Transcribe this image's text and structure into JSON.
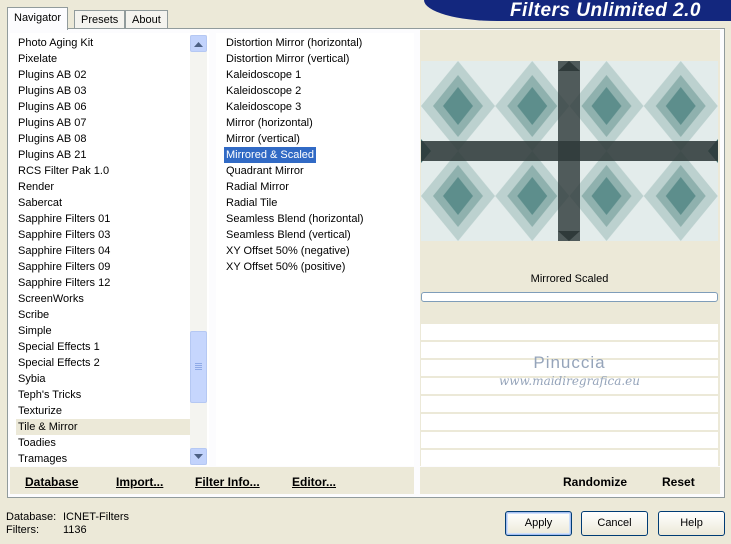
{
  "app_title": "Filters Unlimited 2.0",
  "tabs": [
    {
      "label": "Navigator",
      "active": true
    },
    {
      "label": "Presets",
      "active": false
    },
    {
      "label": "About",
      "active": false
    }
  ],
  "categories": [
    "Photo Aging Kit",
    "Pixelate",
    "Plugins AB 02",
    "Plugins AB 03",
    "Plugins AB 06",
    "Plugins AB 07",
    "Plugins AB 08",
    "Plugins AB 21",
    "RCS Filter Pak 1.0",
    "Render",
    "Sabercat",
    "Sapphire Filters 01",
    "Sapphire Filters 03",
    "Sapphire Filters 04",
    "Sapphire Filters 09",
    "Sapphire Filters 12",
    "ScreenWorks",
    "Scribe",
    "Simple",
    "Special Effects 1",
    "Special Effects 2",
    "Sybia",
    "Teph's Tricks",
    "Texturize",
    "Tile & Mirror",
    "Toadies",
    "Tramages"
  ],
  "selected_category": "Tile & Mirror",
  "filters": [
    "Distortion Mirror (horizontal)",
    "Distortion Mirror (vertical)",
    "Kaleidoscope 1",
    "Kaleidoscope 2",
    "Kaleidoscope 3",
    "Mirror (horizontal)",
    "Mirror (vertical)",
    "Mirrored & Scaled",
    "Quadrant Mirror",
    "Radial Mirror",
    "Radial Tile",
    "Seamless Blend (horizontal)",
    "Seamless Blend (vertical)",
    "XY Offset 50% (negative)",
    "XY Offset 50% (positive)"
  ],
  "selected_filter": "Mirrored & Scaled",
  "toolbar": {
    "database": "Database",
    "import": "Import...",
    "filter_info": "Filter Info...",
    "editor": "Editor...",
    "randomize": "Randomize",
    "reset": "Reset"
  },
  "preview": {
    "caption": "Mirrored  Scaled",
    "watermark_name": "Pinuccia",
    "watermark_url": "www.maidiregrafica.eu"
  },
  "status": {
    "database_label": "Database:",
    "database_value": "ICNET-Filters",
    "filters_label": "Filters:",
    "filters_value": "1136"
  },
  "buttons": {
    "apply": "Apply",
    "cancel": "Cancel",
    "help": "Help"
  },
  "colors": {
    "banner": "#13277e",
    "selection": "#316ac5",
    "preview_teal": "#5d8e8c",
    "preview_dark": "#2f3a3a"
  },
  "icons": {
    "scroll_up": "triangle-up",
    "scroll_down": "triangle-down"
  }
}
